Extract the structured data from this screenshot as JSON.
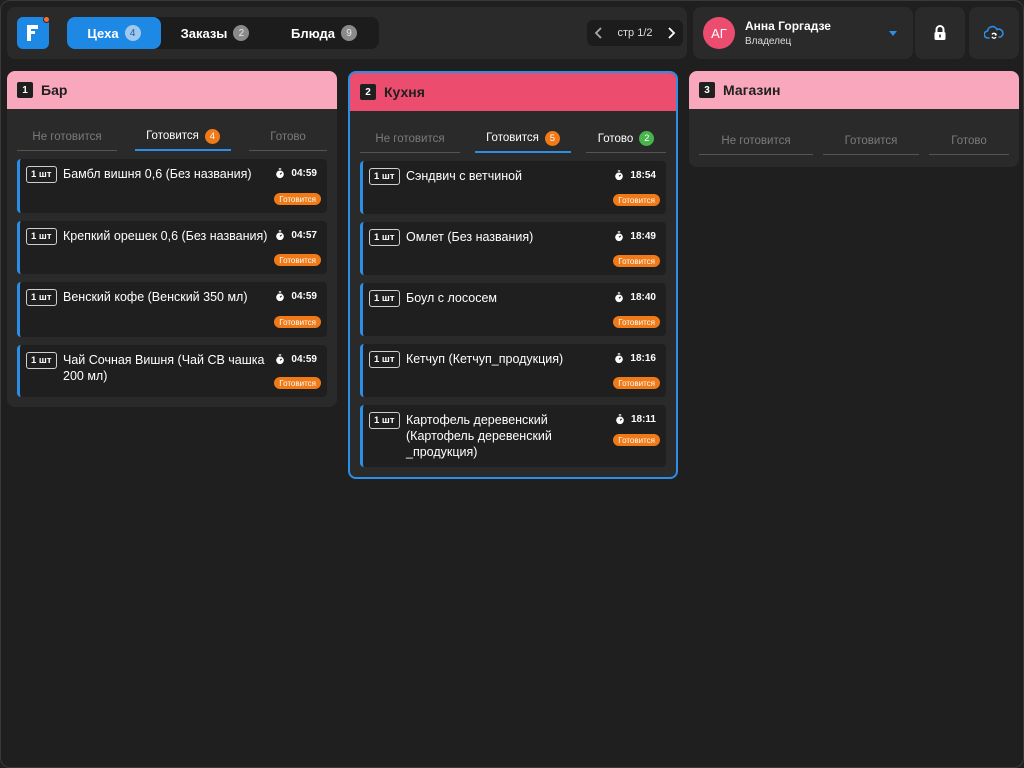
{
  "header": {
    "tabs": [
      {
        "label": "Цеха",
        "count": "4",
        "active": true
      },
      {
        "label": "Заказы",
        "count": "2",
        "active": false
      },
      {
        "label": "Блюда",
        "count": "9",
        "active": false
      }
    ],
    "page_indicator": "стр 1/2",
    "user": {
      "initials": "АГ",
      "name": "Анна Горгадзе",
      "role": "Владелец"
    }
  },
  "colors": {
    "accent": "#1e88e5",
    "orange": "#f07a17",
    "green": "#47b54b",
    "bar_header": "#f8a7bd",
    "kitchen_header": "#ec4d6f",
    "shop_header": "#f8a7bd"
  },
  "columns": [
    {
      "number": "1",
      "title": "Бар",
      "status_tabs": {
        "not_cooking": "Не готовится",
        "cooking": "Готовится",
        "cooking_count": "4",
        "done": "Готово"
      },
      "items": [
        {
          "qty": "1 шт",
          "name": "Бамбл вишня 0,6 (Без названия)",
          "time": "04:59",
          "status": "Готовится"
        },
        {
          "qty": "1 шт",
          "name": "Крепкий орешек 0,6 (Без названия)",
          "time": "04:57",
          "status": "Готовится"
        },
        {
          "qty": "1 шт",
          "name": "Венский кофе (Венский 350 мл)",
          "time": "04:59",
          "status": "Готовится"
        },
        {
          "qty": "1 шт",
          "name": "Чай Сочная Вишня (Чай СВ чашка 200 мл)",
          "time": "04:59",
          "status": "Готовится"
        }
      ]
    },
    {
      "number": "2",
      "title": "Кухня",
      "status_tabs": {
        "not_cooking": "Не готовится",
        "cooking": "Готовится",
        "cooking_count": "5",
        "done": "Готово",
        "done_count": "2"
      },
      "items": [
        {
          "qty": "1 шт",
          "name": "Сэндвич с ветчиной",
          "time": "18:54",
          "status": "Готовится"
        },
        {
          "qty": "1 шт",
          "name": "Омлет (Без названия)",
          "time": "18:49",
          "status": "Готовится"
        },
        {
          "qty": "1 шт",
          "name": "Боул с лососем",
          "time": "18:40",
          "status": "Готовится"
        },
        {
          "qty": "1 шт",
          "name": "Кетчуп (Кетчуп_продукция)",
          "time": "18:16",
          "status": "Готовится"
        },
        {
          "qty": "1 шт",
          "name": "Картофель деревенский (Картофель деревенский _продукция)",
          "time": "18:11",
          "status": "Готовится"
        }
      ]
    },
    {
      "number": "3",
      "title": "Магазин",
      "status_tabs": {
        "not_cooking": "Не готовится",
        "cooking": "Готовится",
        "done": "Готово"
      },
      "items": []
    }
  ]
}
